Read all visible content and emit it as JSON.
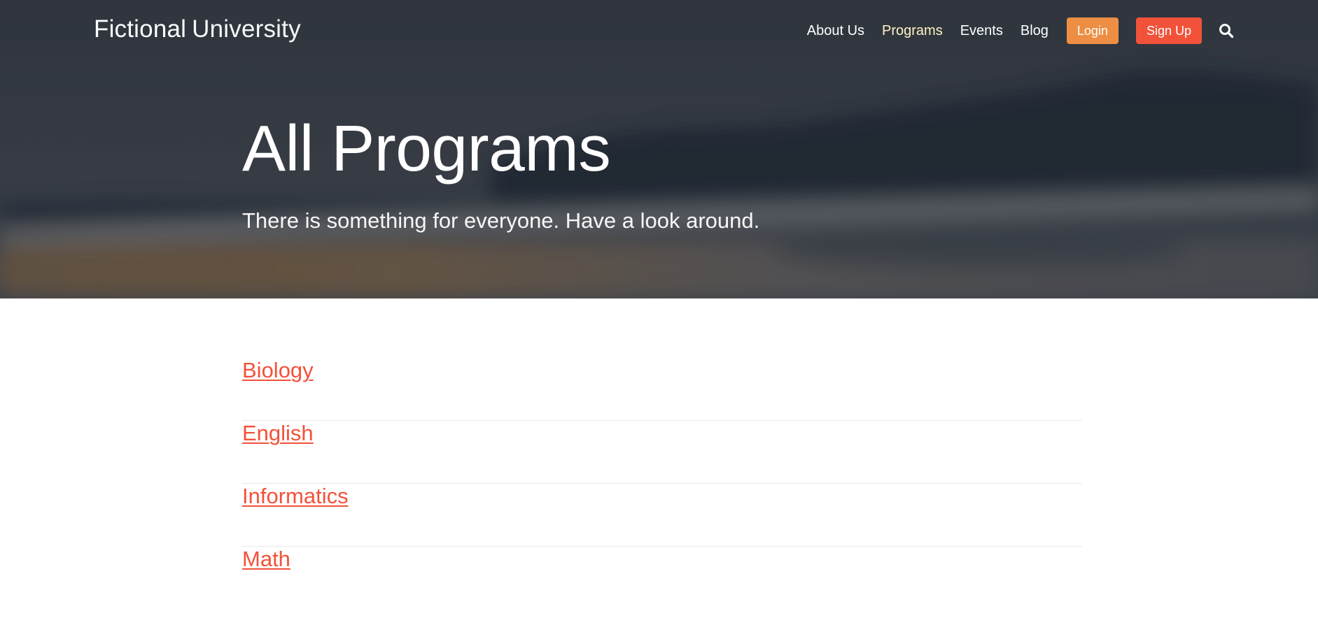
{
  "header": {
    "logo_strong": "Fictional",
    "logo_light": "University",
    "nav": [
      {
        "label": "About Us"
      },
      {
        "label": "Programs",
        "active": true
      },
      {
        "label": "Events"
      },
      {
        "label": "Blog"
      }
    ],
    "login_label": "Login",
    "signup_label": "Sign Up",
    "search_icon": "search-icon"
  },
  "hero": {
    "title": "All Programs",
    "subtitle": "There is something for everyone. Have a look around."
  },
  "programs": [
    {
      "label": "Biology"
    },
    {
      "label": "English"
    },
    {
      "label": "Informatics"
    },
    {
      "label": "Math"
    }
  ],
  "colors": {
    "accent": "#f2523a",
    "login_button": "#ed8e44",
    "active_nav": "#fff2c5"
  }
}
